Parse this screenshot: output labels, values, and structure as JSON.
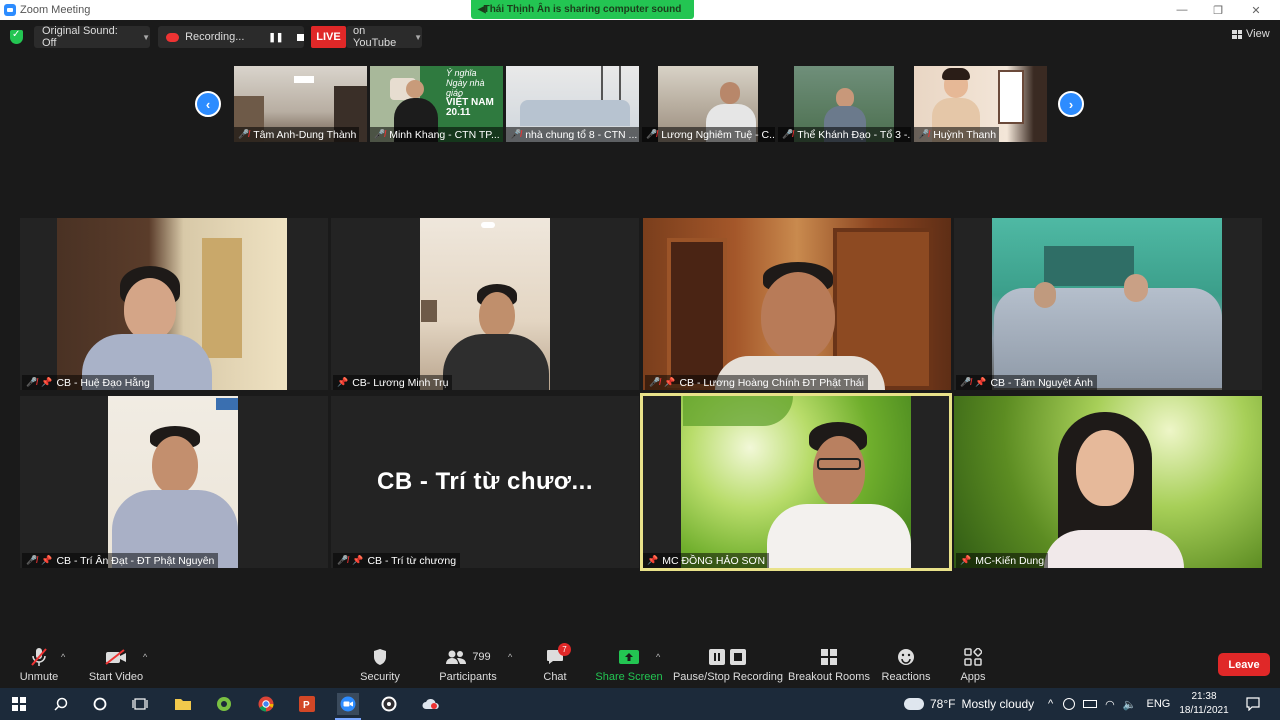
{
  "window": {
    "title": "Zoom Meeting",
    "share_banner": "Thái Thịnh Ân is sharing computer sound"
  },
  "topbar": {
    "original_sound": "Original Sound: Off",
    "recording": "Recording...",
    "live": "LIVE",
    "live_target": "on YouTube",
    "view": "View"
  },
  "filmstrip": [
    {
      "name": "Tâm Anh-Dung Thành"
    },
    {
      "name": "Minh Khang - CTN TP..."
    },
    {
      "name": "nhà chung tổ 8 - CTN ..."
    },
    {
      "name": "Lương Nghiêm Tuệ - C..."
    },
    {
      "name": "Thể Khánh Đạo - Tổ 3 -..."
    },
    {
      "name": "Huỳnh Thanh"
    }
  ],
  "filmstrip_overlay": {
    "line1": "Ý nghĩa",
    "line2": "Ngày nhà giáo",
    "line3": "VIỆT NAM",
    "line4": "20.11"
  },
  "grid": [
    {
      "name": "CB - Huệ Đạo Hằng"
    },
    {
      "name": "CB- Lương Minh Trụ"
    },
    {
      "name": "CB - Lương Hoàng Chính ĐT Phật Thái"
    },
    {
      "name": "CB - Tâm Nguyệt Ánh"
    },
    {
      "name": "CB - Trí Ân Đạt - ĐT Phật Nguyên"
    },
    {
      "name": "CB - Trí từ chương",
      "placeholder": "CB - Trí từ chươ..."
    },
    {
      "name": "MC ĐỒNG HẢO SƠN"
    },
    {
      "name": "MC-Kiến Dung"
    }
  ],
  "toolbar": {
    "unmute": "Unmute",
    "start_video": "Start Video",
    "security": "Security",
    "participants": "Participants",
    "participants_count": "799",
    "chat": "Chat",
    "chat_badge": "7",
    "share_screen": "Share Screen",
    "pause_stop_recording": "Pause/Stop Recording",
    "breakout_rooms": "Breakout Rooms",
    "reactions": "Reactions",
    "apps": "Apps",
    "leave": "Leave"
  },
  "taskbar": {
    "weather": "78°F",
    "weather_desc": "Mostly cloudy",
    "lang": "ENG",
    "time": "21:38",
    "date": "18/11/2021"
  },
  "colors": {
    "accent": "#2d8cff",
    "live": "#e02828",
    "share_green": "#23c552",
    "active_speaker": "#e9e28a"
  }
}
